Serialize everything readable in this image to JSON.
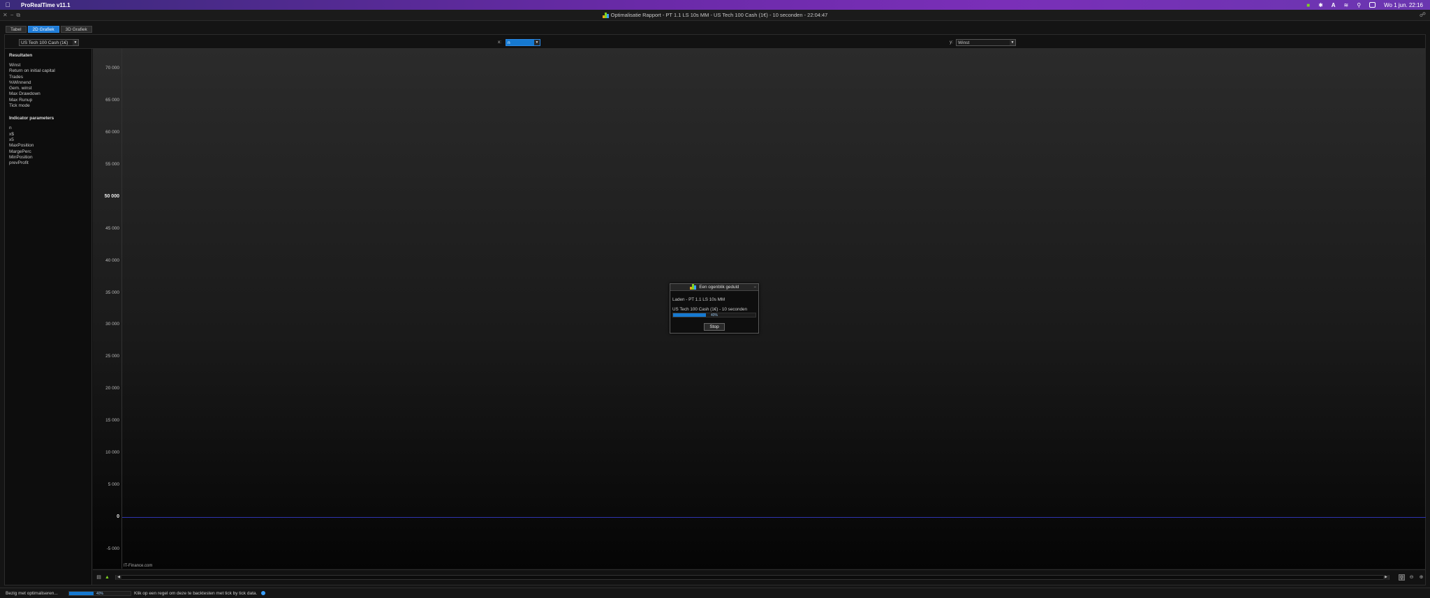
{
  "menubar": {
    "app_name": "ProRealTime v11.1",
    "datetime": "Wo 1 jun.  22:16"
  },
  "window": {
    "title": "Optimalisatie Rapport - PT 1.1 LS 10s MM - US Tech 100 Cash (1€) - 10 seconden - 22:04:47"
  },
  "tabs": [
    {
      "label": "Tabel",
      "active": false
    },
    {
      "label": "2D Grafiek",
      "active": true
    },
    {
      "label": "3D Grafiek",
      "active": false
    }
  ],
  "controls": {
    "instrument": "US Tech 100 Cash (1€)",
    "x_label": "x:",
    "x_value": "n",
    "y_label": "y:",
    "y_value": "Winst"
  },
  "sidebar": {
    "results_header": "Resultaten",
    "results": [
      "Winst",
      "Return on initial capital",
      "Trades",
      "%Winnend",
      "Gem. winst",
      "Max Drawdown",
      "Max Runup",
      "Tick mode"
    ],
    "params_header": "Indicator parameters",
    "params": [
      "n",
      "x$",
      "x5",
      "MaxPosition",
      "MargePerc",
      "MinPosition",
      "prevProfit"
    ]
  },
  "chart_data": {
    "type": "scatter",
    "series": [],
    "ylabel": "",
    "xlabel": "",
    "ylim": [
      -8000,
      73000
    ],
    "y_ticks": [
      "70 000",
      "65 000",
      "60 000",
      "55 000",
      "50 000",
      "45 000",
      "40 000",
      "35 000",
      "30 000",
      "25 000",
      "20 000",
      "15 000",
      "10 000",
      "5 000",
      "0",
      "-5 000"
    ],
    "y_tick_values": [
      70000,
      65000,
      60000,
      55000,
      50000,
      45000,
      40000,
      35000,
      30000,
      25000,
      20000,
      15000,
      10000,
      5000,
      0,
      -5000
    ],
    "bold_ticks": [
      "50 000",
      "0"
    ],
    "grid": false,
    "watermark": "IT-Finance.com"
  },
  "dialog": {
    "title": "Een ogenblik geduld",
    "loading": "Laden - PT 1.1 LS 10s MM",
    "instrument": "US Tech 100 Cash (1€) - 10 seconden",
    "progress": 0.4,
    "progress_text": "40%",
    "stop_label": "Stop"
  },
  "statusbar": {
    "busy_text": "Bezig met optimaliseren...",
    "progress": 0.4,
    "progress_text": "40%",
    "hint": "Klik op een regel om deze te backtesten met tick by tick data."
  },
  "colors": {
    "accent": "#1e7bd6",
    "zero_line": "#2e35b0",
    "menubar": "#6a2aa8"
  }
}
